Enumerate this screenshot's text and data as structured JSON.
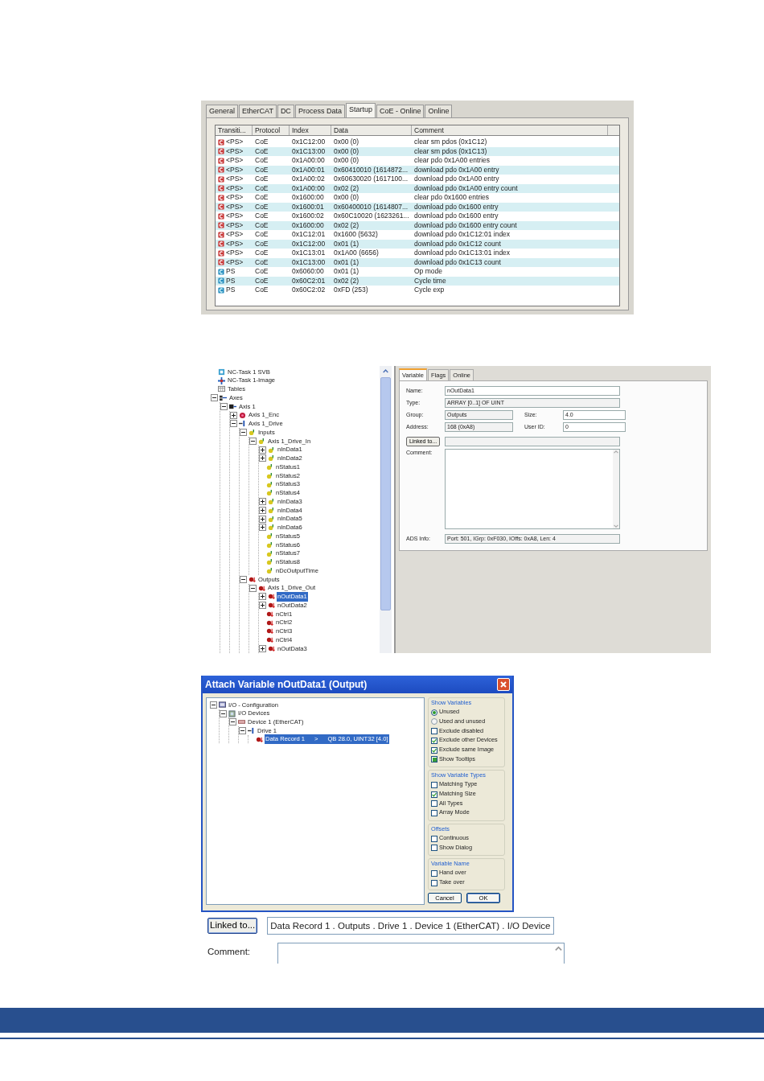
{
  "startup_panel": {
    "tabs": [
      {
        "label": "General",
        "selected": false
      },
      {
        "label": "EtherCAT",
        "selected": false
      },
      {
        "label": "DC",
        "selected": false
      },
      {
        "label": "Process Data",
        "selected": false
      },
      {
        "label": "Startup",
        "selected": true
      },
      {
        "label": "CoE - Online",
        "selected": false
      },
      {
        "label": "Online",
        "selected": false
      }
    ],
    "columns": [
      "Transiti...",
      "Protocol",
      "Index",
      "Data",
      "Comment"
    ],
    "rows": [
      {
        "kind": "fixed",
        "transition": "<PS>",
        "protocol": "CoE",
        "index": "0x1C12:00",
        "data": "0x00 (0)",
        "comment": "clear sm pdos (0x1C12)"
      },
      {
        "kind": "fixed",
        "transition": "<PS>",
        "protocol": "CoE",
        "index": "0x1C13:00",
        "data": "0x00 (0)",
        "comment": "clear sm pdos (0x1C13)"
      },
      {
        "kind": "fixed",
        "transition": "<PS>",
        "protocol": "CoE",
        "index": "0x1A00:00",
        "data": "0x00 (0)",
        "comment": "clear pdo 0x1A00 entries"
      },
      {
        "kind": "fixed",
        "transition": "<PS>",
        "protocol": "CoE",
        "index": "0x1A00:01",
        "data": "0x60410010 (1614872...",
        "comment": "download pdo 0x1A00 entry"
      },
      {
        "kind": "fixed",
        "transition": "<PS>",
        "protocol": "CoE",
        "index": "0x1A00:02",
        "data": "0x60630020 (1617100...",
        "comment": "download pdo 0x1A00 entry"
      },
      {
        "kind": "fixed",
        "transition": "<PS>",
        "protocol": "CoE",
        "index": "0x1A00:00",
        "data": "0x02 (2)",
        "comment": "download pdo 0x1A00 entry count"
      },
      {
        "kind": "fixed",
        "transition": "<PS>",
        "protocol": "CoE",
        "index": "0x1600:00",
        "data": "0x00 (0)",
        "comment": "clear pdo 0x1600 entries"
      },
      {
        "kind": "fixed",
        "transition": "<PS>",
        "protocol": "CoE",
        "index": "0x1600:01",
        "data": "0x60400010 (1614807...",
        "comment": "download pdo 0x1600 entry"
      },
      {
        "kind": "fixed",
        "transition": "<PS>",
        "protocol": "CoE",
        "index": "0x1600:02",
        "data": "0x60C10020 (1623261...",
        "comment": "download pdo 0x1600 entry"
      },
      {
        "kind": "fixed",
        "transition": "<PS>",
        "protocol": "CoE",
        "index": "0x1600:00",
        "data": "0x02 (2)",
        "comment": "download pdo 0x1600 entry count"
      },
      {
        "kind": "fixed",
        "transition": "<PS>",
        "protocol": "CoE",
        "index": "0x1C12:01",
        "data": "0x1600 (5632)",
        "comment": "download pdo 0x1C12:01 index"
      },
      {
        "kind": "fixed",
        "transition": "<PS>",
        "protocol": "CoE",
        "index": "0x1C12:00",
        "data": "0x01 (1)",
        "comment": "download pdo 0x1C12 count"
      },
      {
        "kind": "fixed",
        "transition": "<PS>",
        "protocol": "CoE",
        "index": "0x1C13:01",
        "data": "0x1A00 (6656)",
        "comment": "download pdo 0x1C13:01 index"
      },
      {
        "kind": "fixed",
        "transition": "<PS>",
        "protocol": "CoE",
        "index": "0x1C13:00",
        "data": "0x01 (1)",
        "comment": "download pdo 0x1C13 count"
      },
      {
        "kind": "user",
        "transition": "PS",
        "protocol": "CoE",
        "index": "0x6060:00",
        "data": "0x01 (1)",
        "comment": "Op mode"
      },
      {
        "kind": "user",
        "transition": "PS",
        "protocol": "CoE",
        "index": "0x60C2:01",
        "data": "0x02 (2)",
        "comment": "Cycle time"
      },
      {
        "kind": "user",
        "transition": "PS",
        "protocol": "CoE",
        "index": "0x60C2:02",
        "data": "0xFD (253)",
        "comment": "Cycle exp"
      }
    ]
  },
  "variable_view": {
    "tree": [
      {
        "kind": "task",
        "label": "NC-Task 1 SVB",
        "selected": false
      },
      {
        "kind": "image",
        "label": "NC-Task 1-Image",
        "selected": false
      },
      {
        "kind": "table",
        "label": "Tables",
        "selected": false
      },
      {
        "kind": "axes",
        "label": "Axes",
        "selected": false,
        "expanded": true,
        "children": [
          {
            "kind": "axis",
            "label": "Axis 1",
            "selected": false,
            "expanded": true,
            "children": [
              {
                "kind": "encoder",
                "label": "Axis 1_Enc",
                "selected": false,
                "expanded": false
              },
              {
                "kind": "drive",
                "label": "Axis 1_Drive",
                "selected": false,
                "expanded": true,
                "children": [
                  {
                    "kind": "input",
                    "label": "Inputs",
                    "selected": false,
                    "expanded": true,
                    "children": [
                      {
                        "kind": "input",
                        "label": "Axis 1_Drive_In",
                        "selected": false,
                        "expanded": true,
                        "children": [
                          {
                            "kind": "input",
                            "label": "nInData1",
                            "selected": false,
                            "expanded": false
                          },
                          {
                            "kind": "input",
                            "label": "nInData2",
                            "selected": false,
                            "expanded": false
                          },
                          {
                            "kind": "input",
                            "label": "nStatus1",
                            "selected": false
                          },
                          {
                            "kind": "input",
                            "label": "nStatus2",
                            "selected": false
                          },
                          {
                            "kind": "input",
                            "label": "nStatus3",
                            "selected": false
                          },
                          {
                            "kind": "input",
                            "label": "nStatus4",
                            "selected": false
                          },
                          {
                            "kind": "input",
                            "label": "nInData3",
                            "selected": false,
                            "expanded": false
                          },
                          {
                            "kind": "input",
                            "label": "nInData4",
                            "selected": false,
                            "expanded": false
                          },
                          {
                            "kind": "input",
                            "label": "nInData5",
                            "selected": false,
                            "expanded": false
                          },
                          {
                            "kind": "input",
                            "label": "nInData6",
                            "selected": false,
                            "expanded": false
                          },
                          {
                            "kind": "input",
                            "label": "nStatus5",
                            "selected": false
                          },
                          {
                            "kind": "input",
                            "label": "nStatus6",
                            "selected": false
                          },
                          {
                            "kind": "input",
                            "label": "nStatus7",
                            "selected": false
                          },
                          {
                            "kind": "input",
                            "label": "nStatus8",
                            "selected": false
                          },
                          {
                            "kind": "input",
                            "label": "nDcOutputTime",
                            "selected": false
                          }
                        ]
                      }
                    ]
                  },
                  {
                    "kind": "output",
                    "label": "Outputs",
                    "selected": false,
                    "expanded": true,
                    "children": [
                      {
                        "kind": "output",
                        "label": "Axis 1_Drive_Out",
                        "selected": false,
                        "expanded": true,
                        "children": [
                          {
                            "kind": "output",
                            "label": "nOutData1",
                            "selected": true,
                            "expanded": false
                          },
                          {
                            "kind": "output",
                            "label": "nOutData2",
                            "selected": false,
                            "expanded": false
                          },
                          {
                            "kind": "output",
                            "label": "nCtrl1",
                            "selected": false
                          },
                          {
                            "kind": "output",
                            "label": "nCtrl2",
                            "selected": false
                          },
                          {
                            "kind": "output",
                            "label": "nCtrl3",
                            "selected": false
                          },
                          {
                            "kind": "output",
                            "label": "nCtrl4",
                            "selected": false
                          },
                          {
                            "kind": "output",
                            "label": "nOutData3",
                            "selected": false,
                            "expanded": false
                          }
                        ]
                      }
                    ]
                  }
                ]
              }
            ]
          }
        ]
      }
    ],
    "tabs": [
      {
        "label": "Variable",
        "selected": true
      },
      {
        "label": "Flags",
        "selected": false
      },
      {
        "label": "Online",
        "selected": false
      }
    ],
    "form": {
      "name": {
        "label": "Name:",
        "value": "nOutData1"
      },
      "type": {
        "label": "Type:",
        "value": "ARRAY [0..1] OF UINT"
      },
      "group": {
        "label": "Group:",
        "value": "Outputs"
      },
      "size": {
        "label": "Size:",
        "value": "4.0"
      },
      "address": {
        "label": "Address:",
        "value": "168 (0xA8)"
      },
      "user_id": {
        "label": "User ID:",
        "value": "0"
      },
      "linked_button": "Linked to...",
      "comment_label": "Comment:",
      "ads_info": {
        "label": "ADS Info:",
        "value": "Port: 501, IGrp: 0xF030, IOffs: 0xA8, Len: 4"
      }
    }
  },
  "attach_dialog": {
    "title": "Attach Variable nOutData1 (Output)",
    "tree": [
      {
        "kind": "config",
        "label": "I/O - Configuration",
        "selected": false,
        "expanded": true,
        "children": [
          {
            "kind": "devices",
            "label": "I/O Devices",
            "selected": false,
            "expanded": true,
            "children": [
              {
                "kind": "device",
                "label": "Device 1 (EtherCAT)",
                "selected": false,
                "expanded": true,
                "children": [
                  {
                    "kind": "drive",
                    "label": "Drive 1",
                    "selected": false,
                    "expanded": true,
                    "children": [
                      {
                        "kind": "output",
                        "label": "Data Record 1",
                        "marker": ">",
                        "info": "QB 28.0, UINT32 [4.0]",
                        "selected": true
                      }
                    ]
                  }
                ]
              }
            ]
          }
        ]
      }
    ],
    "groups": [
      {
        "title": "Show Variables",
        "options": [
          {
            "kind": "radio",
            "label": "Unused",
            "selected": true
          },
          {
            "kind": "radio",
            "label": "Used and unused",
            "selected": false
          },
          {
            "kind": "checkbox",
            "label": "Exclude disabled",
            "checked": false
          },
          {
            "kind": "checkbox",
            "label": "Exclude other Devices",
            "checked": true
          },
          {
            "kind": "checkbox",
            "label": "Exclude same Image",
            "checked": true
          },
          {
            "kind": "tristate",
            "label": "Show Tooltips",
            "checked": true
          }
        ]
      },
      {
        "title": "Show Variable Types",
        "options": [
          {
            "kind": "checkbox",
            "label": "Matching Type",
            "checked": false
          },
          {
            "kind": "checkbox",
            "label": "Matching Size",
            "checked": true
          },
          {
            "kind": "checkbox",
            "label": "All Types",
            "checked": false
          },
          {
            "kind": "checkbox",
            "label": "Array Mode",
            "checked": false
          }
        ]
      },
      {
        "title": "Offsets",
        "options": [
          {
            "kind": "checkbox",
            "label": "Continuous",
            "checked": false
          },
          {
            "kind": "checkbox",
            "label": "Show Dialog",
            "checked": false
          }
        ]
      },
      {
        "title": "Variable Name",
        "options": [
          {
            "kind": "checkbox",
            "label": "Hand over",
            "checked": false
          },
          {
            "kind": "checkbox",
            "label": "Take over",
            "checked": false
          }
        ]
      }
    ],
    "buttons": [
      {
        "label": "Cancel",
        "default": false
      },
      {
        "label": "OK",
        "default": true
      }
    ]
  },
  "link_detail": {
    "button": "Linked to...",
    "value": "Data Record 1 . Outputs . Drive 1 . Device 1 (EtherCAT) . I/O Device",
    "comment_label": "Comment:"
  }
}
